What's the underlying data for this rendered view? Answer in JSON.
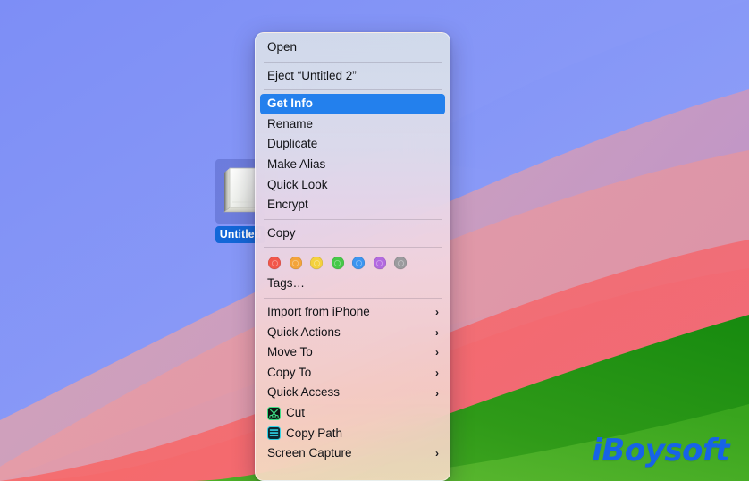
{
  "desktop": {
    "icon": {
      "name": "icon-disk-untitled",
      "label": "Untitled",
      "kind": "external-drive-icon",
      "selected": true
    },
    "watermark": "iBoysoft",
    "wallpaper": {
      "style": "macos-monterey-diagonal-bands",
      "colors": {
        "blue": "#8596f7",
        "blue_light": "#93a2f8",
        "purple": "#bda0cc",
        "mauve": "#cb9fbb",
        "pink": "#e69ba6",
        "red": "#f66a6a",
        "red_light": "#f77f7c",
        "green_dark": "#1d8a14",
        "green": "#3da41f",
        "green_light": "#5cb731"
      }
    }
  },
  "context_menu": {
    "name": "finder-context-menu",
    "accent_color": "#2380ed",
    "groups": [
      {
        "items": [
          {
            "label": "Open",
            "type": "item",
            "name": "menu-item-open"
          }
        ]
      },
      {
        "items": [
          {
            "label": "Eject “Untitled 2”",
            "type": "item",
            "name": "menu-item-eject"
          }
        ]
      },
      {
        "items": [
          {
            "label": "Get Info",
            "type": "item",
            "name": "menu-item-get-info",
            "selected": true
          },
          {
            "label": "Rename",
            "type": "item",
            "name": "menu-item-rename"
          },
          {
            "label": "Duplicate",
            "type": "item",
            "name": "menu-item-duplicate"
          },
          {
            "label": "Make Alias",
            "type": "item",
            "name": "menu-item-make-alias"
          },
          {
            "label": "Quick Look",
            "type": "item",
            "name": "menu-item-quick-look"
          },
          {
            "label": "Encrypt",
            "type": "item",
            "name": "menu-item-encrypt"
          }
        ]
      },
      {
        "items": [
          {
            "label": "Copy",
            "type": "item",
            "name": "menu-item-copy"
          }
        ]
      },
      {
        "items": [
          {
            "type": "tags",
            "name": "menu-tag-colors"
          },
          {
            "label": "Tags…",
            "type": "item",
            "name": "menu-item-tags"
          }
        ]
      },
      {
        "items": [
          {
            "label": "Import from iPhone",
            "type": "submenu",
            "name": "menu-item-import-from-iphone"
          },
          {
            "label": "Quick Actions",
            "type": "submenu",
            "name": "menu-item-quick-actions"
          },
          {
            "label": "Move To",
            "type": "submenu",
            "name": "menu-item-move-to"
          },
          {
            "label": "Copy To",
            "type": "submenu",
            "name": "menu-item-copy-to"
          },
          {
            "label": "Quick Access",
            "type": "submenu",
            "name": "menu-item-quick-access"
          },
          {
            "label": "Cut",
            "type": "item",
            "name": "menu-item-cut",
            "icon": "scissors-icon"
          },
          {
            "label": "Copy Path",
            "type": "item",
            "name": "menu-item-copy-path",
            "icon": "copy-path-icon"
          },
          {
            "label": "Screen Capture",
            "type": "submenu",
            "name": "menu-item-screen-capture"
          }
        ]
      }
    ],
    "tag_colors": [
      {
        "name": "tag-red",
        "hex": "#f2564a"
      },
      {
        "name": "tag-orange",
        "hex": "#f3a43a"
      },
      {
        "name": "tag-yellow",
        "hex": "#f4d13e"
      },
      {
        "name": "tag-green",
        "hex": "#46c848"
      },
      {
        "name": "tag-blue",
        "hex": "#3c95f0"
      },
      {
        "name": "tag-purple",
        "hex": "#b濃"
      }
    ],
    "tag_colors_fixed": [
      {
        "name": "tag-red",
        "hex": "#f2564a"
      },
      {
        "name": "tag-orange",
        "hex": "#f3a43a"
      },
      {
        "name": "tag-yellow",
        "hex": "#f4d13e"
      },
      {
        "name": "tag-green",
        "hex": "#46c848"
      },
      {
        "name": "tag-blue",
        "hex": "#3c95f0"
      },
      {
        "name": "tag-purple",
        "hex": "#b36ae0"
      },
      {
        "name": "tag-gray",
        "hex": "#9b9b9e"
      }
    ],
    "submenu_chevron": "›"
  }
}
